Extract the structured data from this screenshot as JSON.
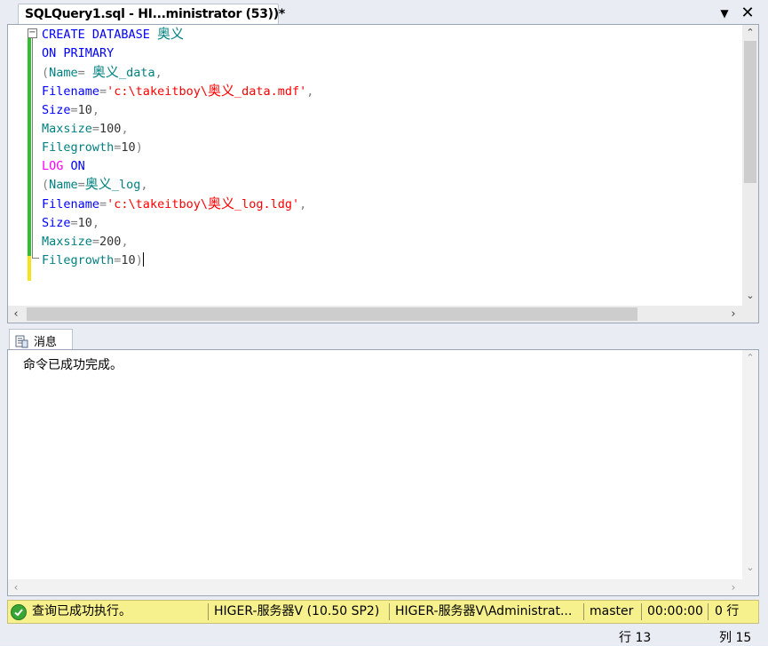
{
  "tab": {
    "title": "SQLQuery1.sql - HI...ministrator (53))*",
    "dropdown_icon": "chevron-down-icon",
    "close_icon": "close-icon"
  },
  "editor": {
    "lines": [
      "CREATE DATABASE 奥义",
      "ON PRIMARY",
      "(Name= 奥义_data,",
      "Filename='c:\\takeitboy\\奥义_data.mdf',",
      "Size=10,",
      "Maxsize=100,",
      "Filegrowth=10)",
      "LOG ON",
      "(Name=奥义_log,",
      "Filename='c:\\takeitboy\\奥义_log.ldg',",
      "Size=10,",
      "Maxsize=200,",
      "Filegrowth=10)"
    ]
  },
  "messages": {
    "tab_label": "消息",
    "text": "命令已成功完成。"
  },
  "status": {
    "query_status": "查询已成功执行。",
    "server": "HIGER-服务器V (10.50 SP2)",
    "user": "HIGER-服务器V\\Administrat...",
    "database": "master",
    "elapsed": "00:00:00",
    "rows": "0 行",
    "success_color": "#3aa535",
    "bar_color": "#f6f08d"
  },
  "cursor": {
    "line": "行 13",
    "column": "列 15"
  }
}
